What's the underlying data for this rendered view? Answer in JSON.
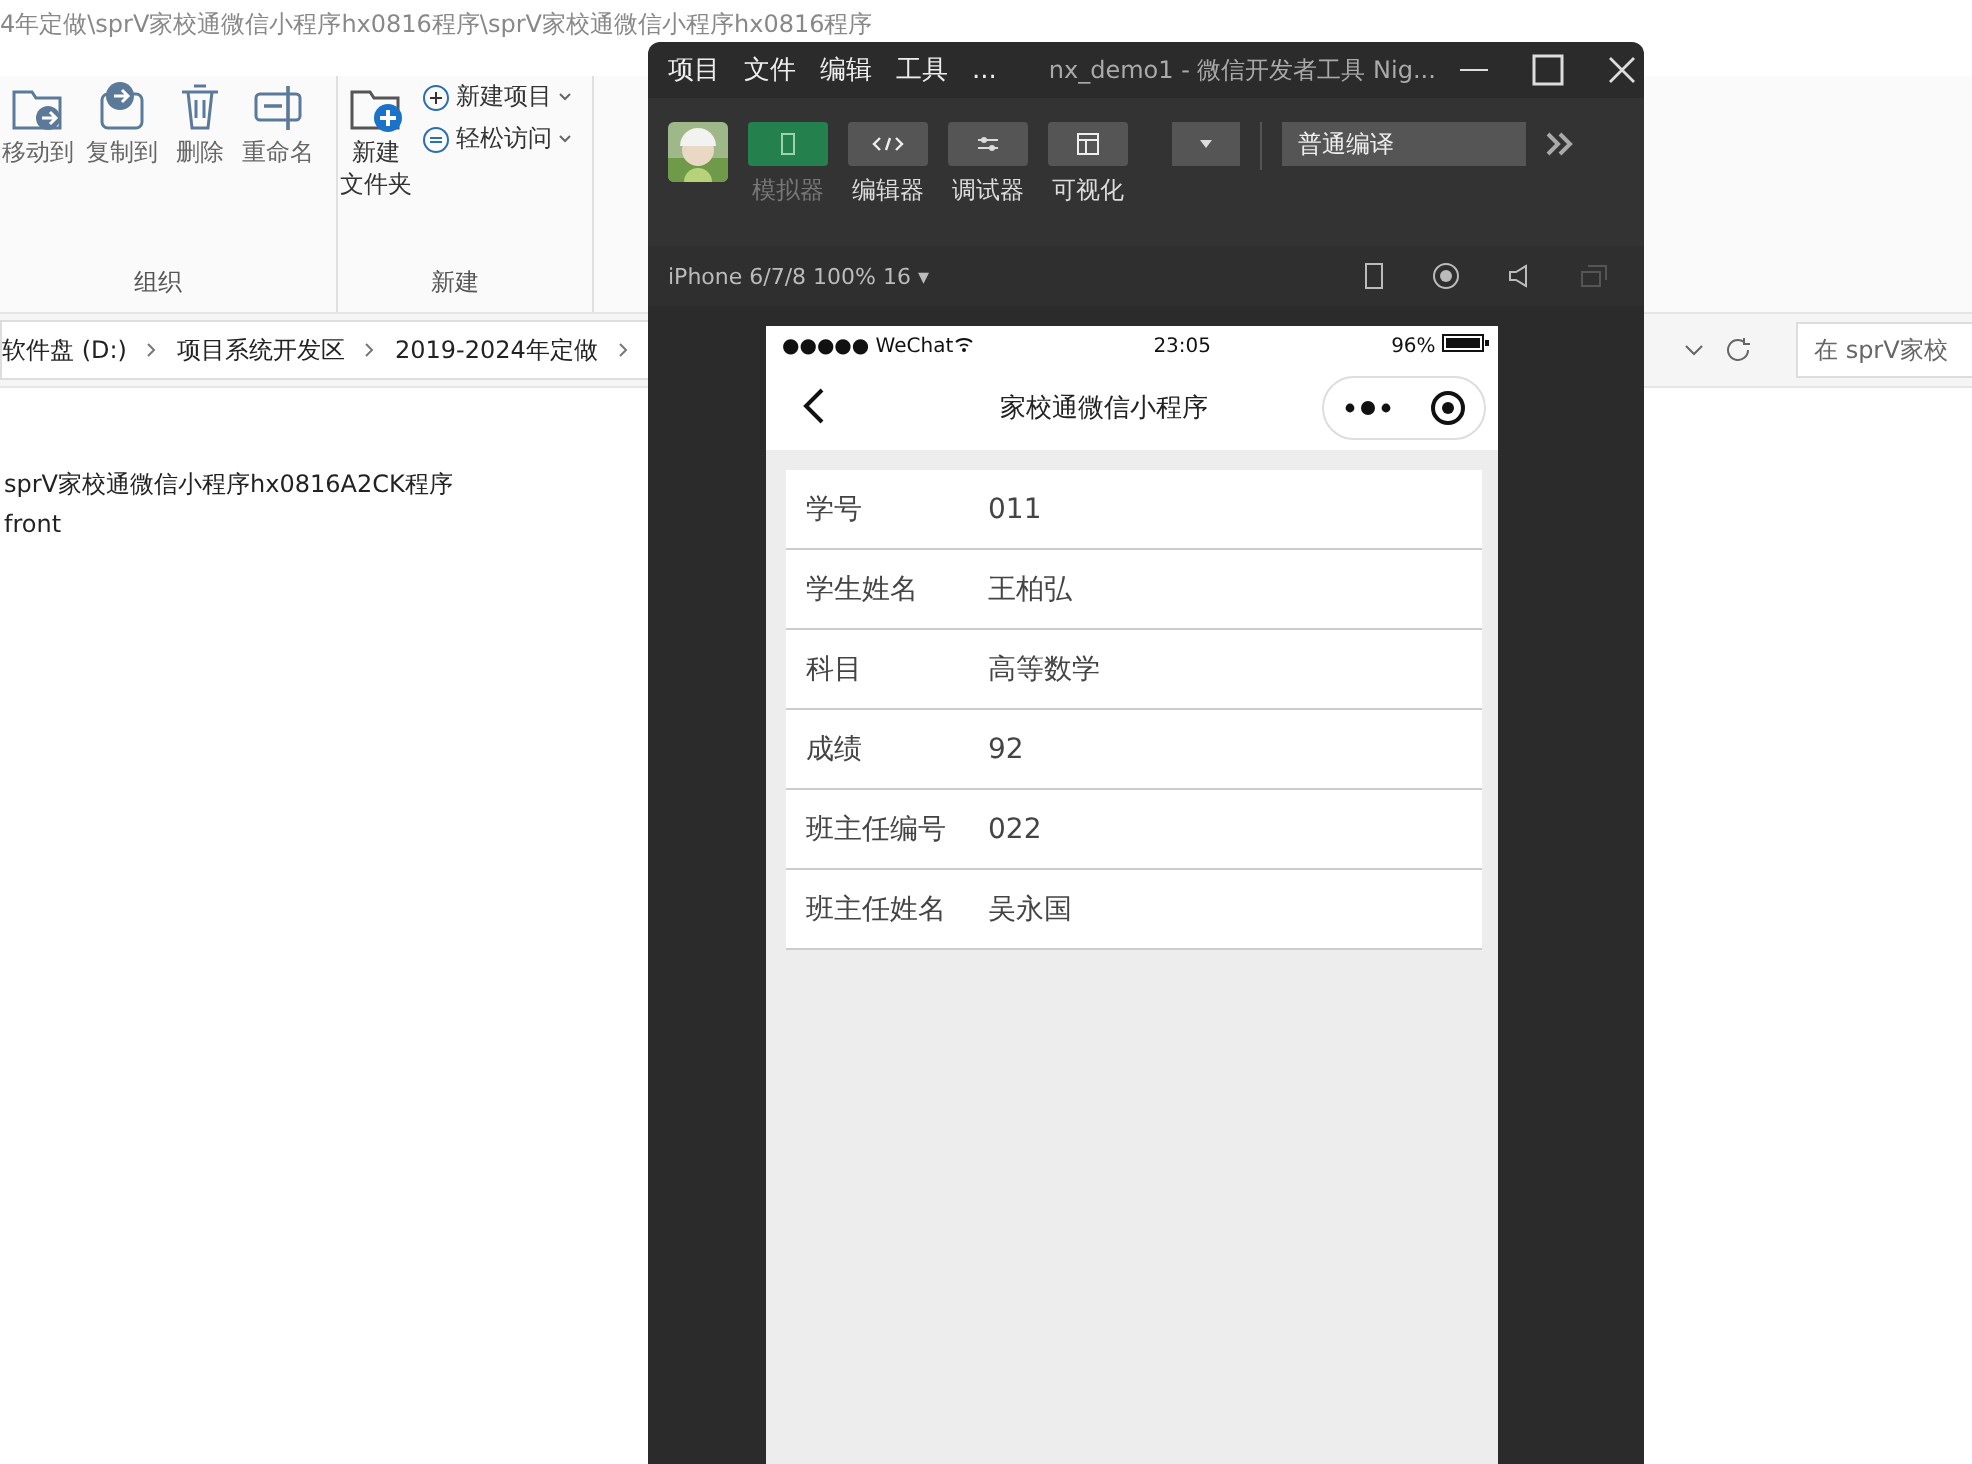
{
  "explorer": {
    "path_title": "4年定做\\sprV家校通微信小程序hx0816程序\\sprV家校通微信小程序hx0816程序",
    "ribbon_groups": [
      {
        "label": "组织",
        "buttons": [
          {
            "label": "移动到",
            "kind": "move"
          },
          {
            "label": "复制到",
            "kind": "copy"
          },
          {
            "label": "删除",
            "kind": "delete"
          },
          {
            "label": "重命名",
            "kind": "rename"
          }
        ]
      },
      {
        "label": "新建",
        "buttons": [
          {
            "label_lines": [
              "新建",
              "文件夹"
            ],
            "kind": "newfolder"
          }
        ],
        "small_buttons": [
          {
            "label": "新建项目",
            "kind": "plus"
          },
          {
            "label": "轻松访问",
            "kind": "access"
          }
        ]
      }
    ],
    "breadcrumbs": [
      "软件盘 (D:)",
      "项目系统开发区",
      "2019-2024年定做"
    ],
    "search": {
      "placeholder": "在 sprV家校"
    },
    "files": [
      {
        "name": "sprV家校通微信小程序hx0816A2CK程序"
      },
      {
        "name": "front"
      }
    ]
  },
  "devtools": {
    "menu": [
      "项目",
      "文件",
      "编辑",
      "工具",
      "..."
    ],
    "title": "nx_demo1 - 微信开发者工具 Nig...",
    "tools": [
      {
        "label": "模拟器",
        "kind": "phone",
        "selected": true
      },
      {
        "label": "编辑器",
        "kind": "code",
        "selected": false
      },
      {
        "label": "调试器",
        "kind": "debug",
        "selected": false
      },
      {
        "label": "可视化",
        "kind": "layout",
        "selected": false
      }
    ],
    "compile_mode": "普通编译",
    "device": "iPhone 6/7/8 100% 16 ▾"
  },
  "phone": {
    "signal": "●●●●● WeChat",
    "time": "23:05",
    "battery": "96%",
    "nav_title": "家校通微信小程序",
    "rows": [
      {
        "label": "学号",
        "value": "011"
      },
      {
        "label": "学生姓名",
        "value": "王柏弘"
      },
      {
        "label": "科目",
        "value": "高等数学"
      },
      {
        "label": "成绩",
        "value": "92"
      },
      {
        "label": "班主任编号",
        "value": "022"
      },
      {
        "label": "班主任姓名",
        "value": "吴永国"
      }
    ]
  }
}
